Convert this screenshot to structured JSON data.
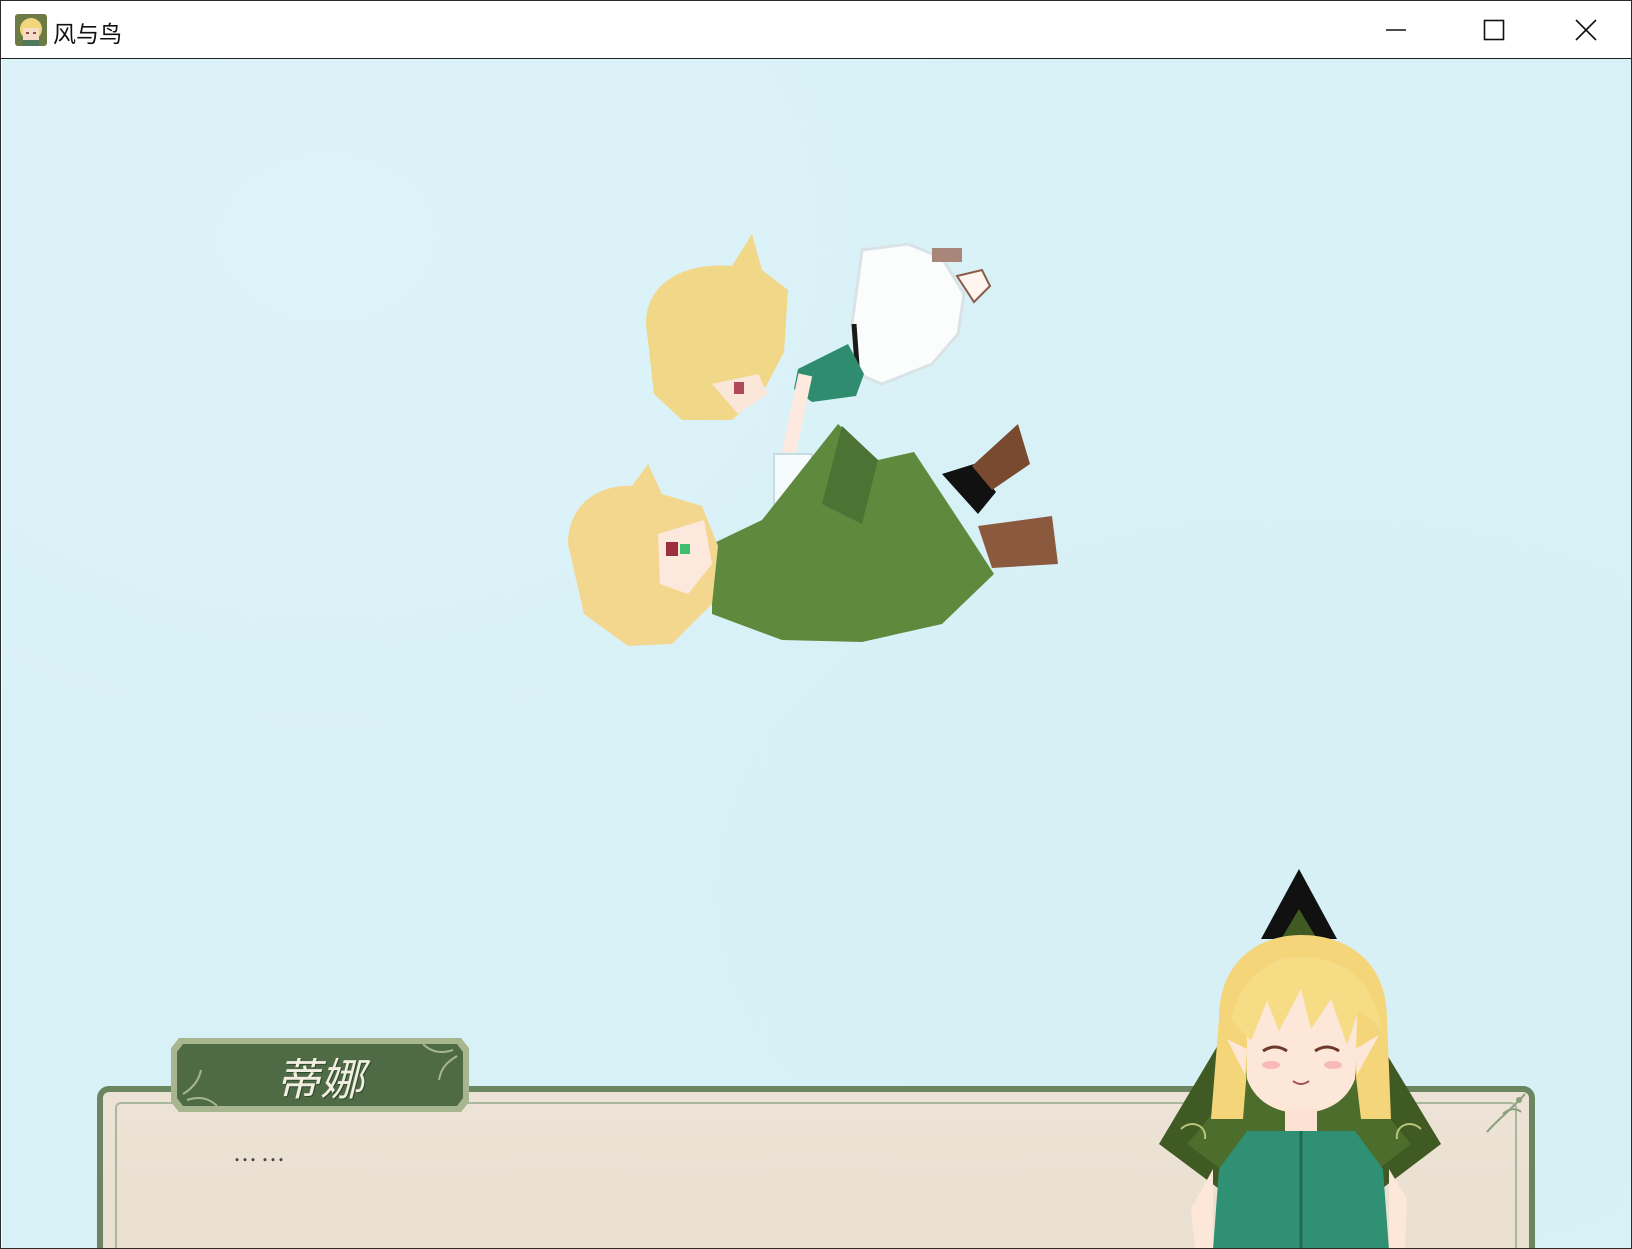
{
  "window": {
    "title": "风与鸟",
    "app_icon": "game-face-icon",
    "controls": [
      "minimize-icon",
      "maximize-icon",
      "close-icon"
    ]
  },
  "scene": {
    "sprites": [
      "fairy-girl-sprite",
      "elf-boy-sprite"
    ],
    "background_color": "#d8f1f7"
  },
  "dialogue": {
    "speaker": "蒂娜",
    "text": "……",
    "portrait": "tina-portrait"
  },
  "colors": {
    "frame_green": "#6b8560",
    "nameplate_green": "#4e6b46",
    "paper": "#ece3d6"
  }
}
